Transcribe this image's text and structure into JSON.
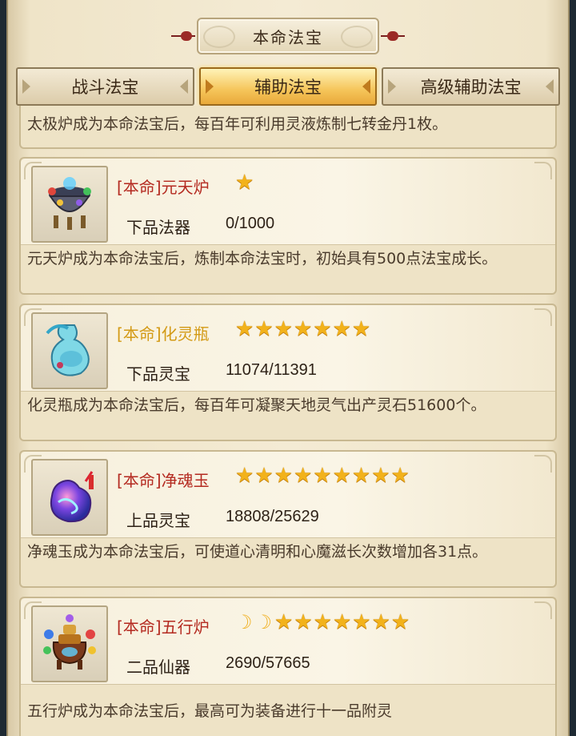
{
  "title": "本命法宝",
  "tabs": [
    {
      "label": "战斗法宝",
      "active": false
    },
    {
      "label": "辅助法宝",
      "active": true
    },
    {
      "label": "高级辅助法宝",
      "active": false
    }
  ],
  "top_desc": "太极炉成为本命法宝后，每百年可利用灵液炼制七转金丹1枚。",
  "items": [
    {
      "name": "[本命]元天炉",
      "name_color": "#b42a20",
      "stars": 1,
      "moons": 0,
      "grade": "下品法器",
      "progress": "0/1000",
      "desc": "元天炉成为本命法宝后，炼制本命法宝时，初始具有500点法宝成长。",
      "icon": "cauldron-icon"
    },
    {
      "name": "[本命]化灵瓶",
      "name_color": "#d39a15",
      "stars": 7,
      "moons": 0,
      "grade": "下品灵宝",
      "progress": "11074/11391",
      "desc": "化灵瓶成为本命法宝后，每百年可凝聚天地灵气出产灵石51600个。",
      "icon": "gourd-bottle-icon"
    },
    {
      "name": "[本命]净魂玉",
      "name_color": "#b42a20",
      "stars": 9,
      "moons": 0,
      "grade": "上品灵宝",
      "progress": "18808/25629",
      "desc": "净魂玉成为本命法宝后，可使道心清明和心魔滋长次数增加各31点。",
      "icon": "soul-jade-icon"
    },
    {
      "name": "[本命]五行炉",
      "name_color": "#b42a20",
      "stars": 7,
      "moons": 2,
      "grade": "二品仙器",
      "progress": "2690/57665",
      "desc": "五行炉成为本命法宝后，最高可为装备进行十一品附灵",
      "icon": "five-elements-furnace-icon"
    }
  ]
}
